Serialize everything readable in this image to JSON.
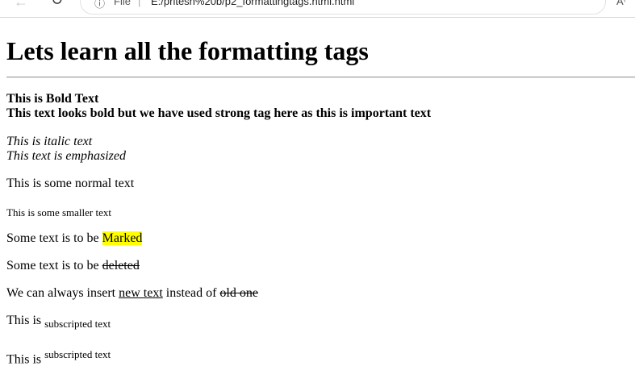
{
  "browser": {
    "file_label": "File",
    "url": "E:/pritesh%20b/p2_formattingtags.html.html"
  },
  "page": {
    "heading": "Lets learn all the formatting tags",
    "bold_text": "This is Bold Text",
    "strong_text": "This text looks bold but we have used strong tag here as this is important text",
    "italic_text": "This is italic text",
    "emphasized_text": "This text is emphasized",
    "normal_text": "This is some normal text",
    "small_text": "This is some smaller text",
    "mark_prefix": "Some text is to be ",
    "mark_text": "Marked",
    "del_prefix": "Some text is to be ",
    "del_text": "deleted",
    "ins_prefix": "We can always insert ",
    "ins_text": "new text",
    "ins_middle": " instead of ",
    "ins_del_text": "old one",
    "sub_prefix": "This is ",
    "sub_text": "subscripted text",
    "sup_prefix": "This is ",
    "sup_text": "subscripted text"
  }
}
